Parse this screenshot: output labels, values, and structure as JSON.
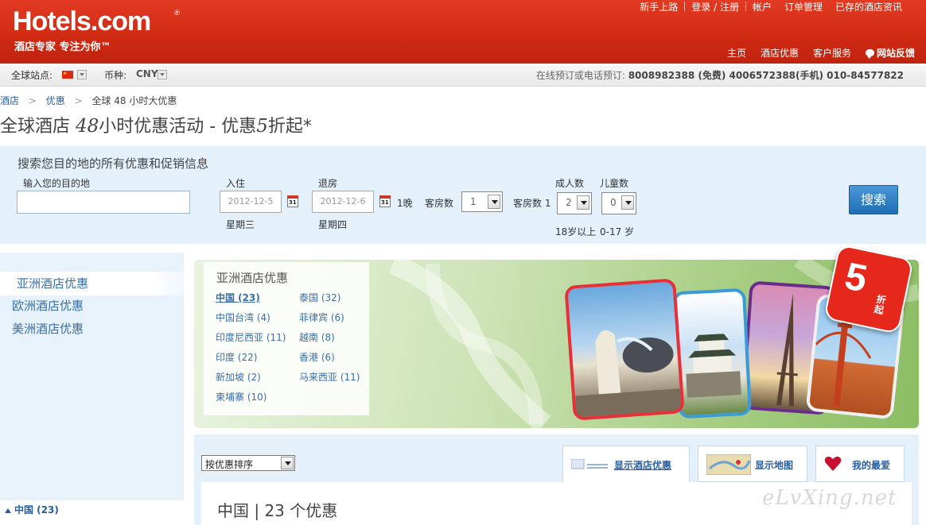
{
  "header": {
    "logo_text": "Hotels.com",
    "logo_reg": "®",
    "slogan": "酒店专家 专注为你™",
    "top_links": [
      "新手上路",
      "登录 / 注册",
      "帐户",
      "订单管理",
      "已存的酒店资讯"
    ],
    "nav": [
      "主页",
      "酒店优惠",
      "客户服务"
    ],
    "feedback": "网站反馈",
    "brand_color": "#d52b14"
  },
  "locale": {
    "site_label": "全球站点:",
    "currency_label": "币种:",
    "currency_value": "CNY",
    "phone_label": "在线预订或电话预订:",
    "phone_numbers": "8008982388 (免费) 4006572388(手机) 010-84577822"
  },
  "breadcrumb": {
    "items": [
      "酒店",
      "优惠",
      "全球 48 小时大优惠"
    ],
    "separator": ">"
  },
  "page_title": {
    "prefix": "全球酒店 ",
    "num1": "48",
    "middle": "小时优惠活动 - 优惠",
    "num2": "5",
    "suffix": "折起*"
  },
  "search": {
    "heading": "搜索您目的地的所有优惠和促销信息",
    "destination_label": "输入您的目的地",
    "destination_value": "",
    "checkin_label": "入住",
    "checkin_value": "2012-12-5",
    "checkin_weekday": "星期三",
    "checkout_label": "退房",
    "checkout_value": "2012-12-6",
    "checkout_weekday": "星期四",
    "calendar_day": "31",
    "nights": "1晚",
    "rooms_label": "客房数",
    "rooms_value": "1",
    "room_count_label": "客房数 1",
    "adults_label": "成人数",
    "adults_value": "2",
    "adults_note": "18岁以上",
    "children_label": "儿童数",
    "children_value": "0",
    "children_note": "0-17 岁",
    "button": "搜索"
  },
  "regions": [
    "亚洲酒店优惠",
    "欧洲酒店优惠",
    "美洲酒店优惠"
  ],
  "asia_box": {
    "title": "亚洲酒店优惠",
    "countries": [
      {
        "name": "中国 (23)",
        "active": true
      },
      {
        "name": "泰国 (32)",
        "active": false
      },
      {
        "name": "中国台湾 (4)",
        "active": false
      },
      {
        "name": "菲律宾 (6)",
        "active": false
      },
      {
        "name": "印度尼西亚 (11)",
        "active": false
      },
      {
        "name": "越南 (8)",
        "active": false
      },
      {
        "name": "印度 (22)",
        "active": false
      },
      {
        "name": "香港 (6)",
        "active": false
      },
      {
        "name": "新加坡 (2)",
        "active": false
      },
      {
        "name": "马来西亚 (11)",
        "active": false
      },
      {
        "name": "柬埔寨 (10)",
        "active": false
      }
    ]
  },
  "badge": {
    "number": "5",
    "text": "折起",
    "color": "#e5281b"
  },
  "results": {
    "sort_value": "按优惠排序",
    "tabs": [
      "显示酒店优惠",
      "显示地图",
      "我的最爱"
    ],
    "heading": "中国 | 23 个优惠"
  },
  "left_filter": "中国 (23)",
  "watermark": "eLvXing.net"
}
